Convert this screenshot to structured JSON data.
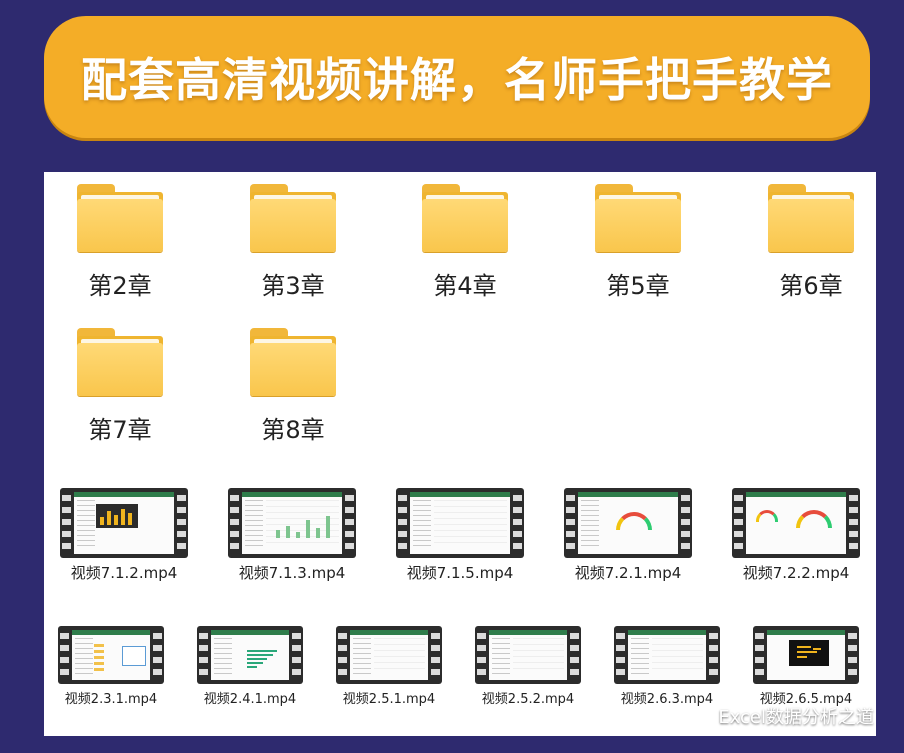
{
  "banner": {
    "title": "配套高清视频讲解，名师手把手教学"
  },
  "folders": [
    {
      "label": "第2章",
      "icon": "folder-icon"
    },
    {
      "label": "第3章",
      "icon": "folder-icon"
    },
    {
      "label": "第4章",
      "icon": "folder-icon"
    },
    {
      "label": "第5章",
      "icon": "folder-icon"
    },
    {
      "label": "第6章",
      "icon": "folder-icon"
    },
    {
      "label": "第7章",
      "icon": "folder-icon"
    },
    {
      "label": "第8章",
      "icon": "folder-icon"
    }
  ],
  "videos_row1": [
    {
      "label": "视频7.1.2.mp4",
      "icon": "video-file-icon"
    },
    {
      "label": "视频7.1.3.mp4",
      "icon": "video-file-icon"
    },
    {
      "label": "视频7.1.5.mp4",
      "icon": "video-file-icon"
    },
    {
      "label": "视频7.2.1.mp4",
      "icon": "video-file-icon"
    },
    {
      "label": "视频7.2.2.mp4",
      "icon": "video-file-icon"
    }
  ],
  "videos_row2": [
    {
      "label": "视频2.3.1.mp4",
      "icon": "video-file-icon"
    },
    {
      "label": "视频2.4.1.mp4",
      "icon": "video-file-icon"
    },
    {
      "label": "视频2.5.1.mp4",
      "icon": "video-file-icon"
    },
    {
      "label": "视频2.5.2.mp4",
      "icon": "video-file-icon"
    },
    {
      "label": "视频2.6.3.mp4",
      "icon": "video-file-icon"
    },
    {
      "label": "视频2.6.5.mp4",
      "icon": "video-file-icon"
    }
  ],
  "watermark": {
    "text": "Excel数据分析之道",
    "icon": "wechat-icon"
  },
  "colors": {
    "background": "#2e2a6f",
    "banner": "#f4ad27",
    "folder": "#f9c64c",
    "panel": "#ffffff"
  }
}
